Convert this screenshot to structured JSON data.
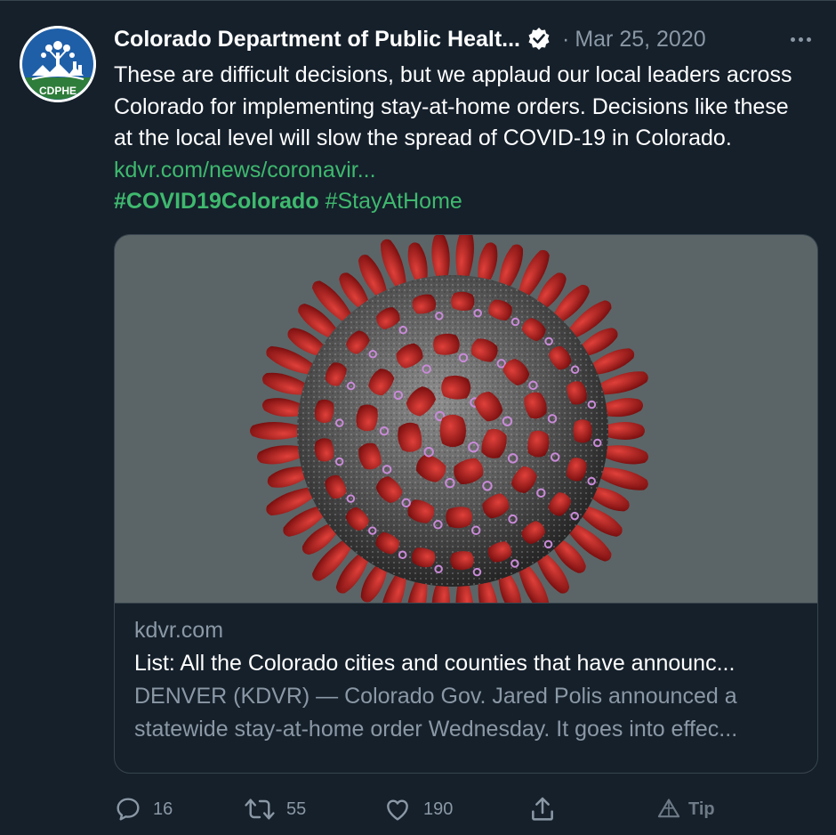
{
  "tweet": {
    "author_name": "Colorado Department of Public Healt...",
    "avatar_label": "CDPHE",
    "date": "Mar 25, 2020",
    "dot_separator": "·",
    "text_part1": "These are difficult decisions, but we applaud our local leaders across Colorado for implementing stay-at-home orders. Decisions like these at the local level will slow the spread of COVID-19 in Colorado. ",
    "link": "kdvr.com/news/coronavir...",
    "hashtag1": "#COVID19Colorado",
    "hashtag2": "#StayAtHome"
  },
  "card": {
    "domain": "kdvr.com",
    "title": "List: All the Colorado cities and counties that have announc...",
    "description": "DENVER (KDVR) — Colorado Gov. Jared Polis announced a statewide stay-at-home order Wednesday. It goes into effec..."
  },
  "actions": {
    "reply_count": "16",
    "retweet_count": "55",
    "like_count": "190",
    "tip_label": "Tip"
  },
  "colors": {
    "background": "#15202b",
    "accent_green": "#3fb96e",
    "muted_text": "#8b98a5",
    "border": "#38444d"
  }
}
